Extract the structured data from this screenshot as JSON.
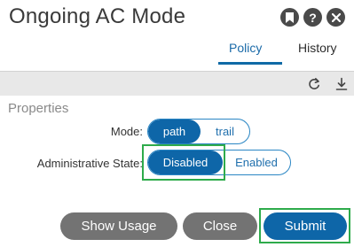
{
  "dialog": {
    "title": "Ongoing AC Mode",
    "header_icons": [
      "bookmark-icon",
      "help-icon",
      "close-icon"
    ]
  },
  "tabs": [
    {
      "label": "Policy",
      "active": true
    },
    {
      "label": "History",
      "active": false
    }
  ],
  "toolbar": {
    "icons": [
      "refresh-icon",
      "download-icon"
    ]
  },
  "properties": {
    "section_title": "Properties",
    "mode": {
      "label": "Mode:",
      "options": [
        "path",
        "trail"
      ],
      "selected": "path"
    },
    "admin_state": {
      "label": "Administrative State:",
      "options": [
        "Disabled",
        "Enabled"
      ],
      "selected": "Disabled"
    }
  },
  "footer": {
    "show_usage_label": "Show Usage",
    "close_label": "Close",
    "submit_label": "Submit"
  },
  "colors": {
    "accent": "#0e66a8",
    "highlight": "#2eab4b",
    "secondary_button": "#737373",
    "toolbar_bg": "#e8e8e8"
  }
}
